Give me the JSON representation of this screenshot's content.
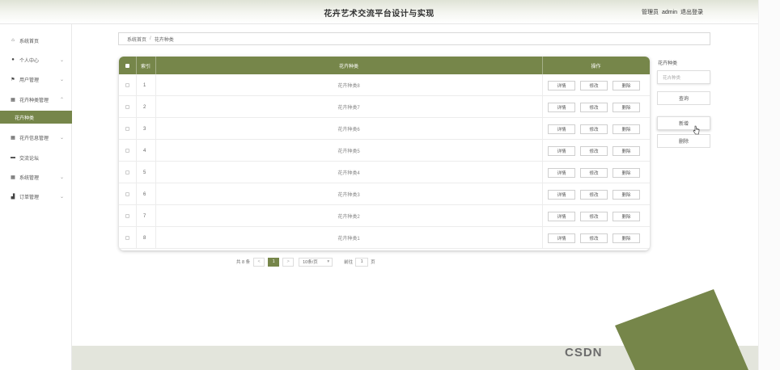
{
  "header": {
    "title": "花卉艺术交流平台设计与实现",
    "user_prefix": "管理员",
    "user_name": "admin",
    "logout": "退出登录"
  },
  "sidebar": {
    "items": [
      {
        "icon": "home-icon",
        "label": "系统首页"
      },
      {
        "icon": "user-icon",
        "label": "个人中心"
      },
      {
        "icon": "flag-icon",
        "label": "用户管理"
      },
      {
        "icon": "grid-icon",
        "label": "花卉种类管理"
      },
      {
        "icon": "",
        "label": "花卉种类"
      },
      {
        "icon": "grid-icon",
        "label": "花卉信息管理"
      },
      {
        "icon": "card-icon",
        "label": "交流论坛"
      },
      {
        "icon": "grid-icon",
        "label": "系统管理"
      },
      {
        "icon": "bar-icon",
        "label": "订单管理"
      }
    ]
  },
  "breadcrumb": {
    "home": "系统首页",
    "separator": "/",
    "current": "花卉种类"
  },
  "table": {
    "headers": {
      "index": "索引",
      "name": "花卉种类",
      "action": "操作"
    },
    "actions": {
      "detail": "详情",
      "edit": "修改",
      "delete": "删除"
    },
    "rows": [
      {
        "index": "1",
        "name": "花卉种类8"
      },
      {
        "index": "2",
        "name": "花卉种类7"
      },
      {
        "index": "3",
        "name": "花卉种类6"
      },
      {
        "index": "4",
        "name": "花卉种类5"
      },
      {
        "index": "5",
        "name": "花卉种类4"
      },
      {
        "index": "6",
        "name": "花卉种类3"
      },
      {
        "index": "7",
        "name": "花卉种类2"
      },
      {
        "index": "8",
        "name": "花卉种类1"
      }
    ]
  },
  "pagination": {
    "total": "共 8 条",
    "prev": "<",
    "current_page": "1",
    "next": ">",
    "page_size": "10条/页",
    "goto_prefix": "前往",
    "goto_value": "1",
    "goto_suffix": "页"
  },
  "filter": {
    "label": "花卉种类",
    "placeholder": "花卉种类",
    "search": "查询",
    "add": "新增",
    "delete": "删除"
  },
  "watermark": "CSDN",
  "colors": {
    "accent": "#76864a",
    "footer": "#e3e5dc"
  }
}
